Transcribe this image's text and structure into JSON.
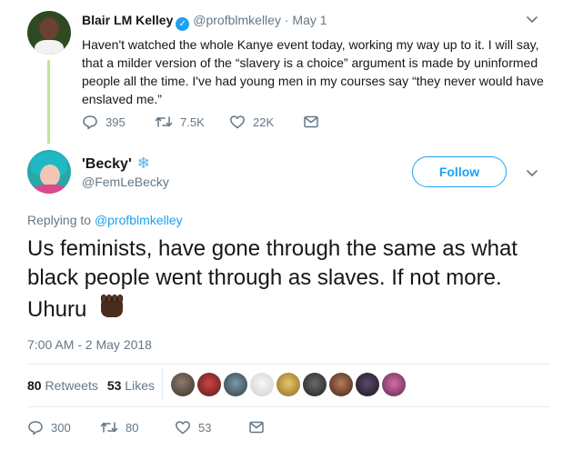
{
  "parent_tweet": {
    "author_name": "Blair LM Kelley",
    "verified_glyph": "✓",
    "handle": "@profblmkelley",
    "dot": "·",
    "date": "May 1",
    "text": "Haven't watched the whole Kanye event today, working my way up to it. I will say, that a milder version of the “slavery is a choice” argument is made by uninformed people all the time. I've had young men in my courses say “they never would have enslaved me.”",
    "actions": {
      "replies": "395",
      "retweets": "7.5K",
      "likes": "22K"
    },
    "icons": [
      "avatar",
      "verified-badge-icon",
      "chevron-down-icon",
      "reply-icon",
      "retweet-icon",
      "like-icon",
      "direct-message-icon"
    ]
  },
  "main_tweet": {
    "author_name": "'Becky'",
    "name_emoji": "❄",
    "handle": "@FemLeBecky",
    "follow_label": "Follow",
    "replying_prefix": "Replying to",
    "replying_to": "@profblmkelley",
    "text": "Us feminists, have gone through the same as what black people went through as slaves. If not more. Uhuru",
    "text_emoji": "raised-fist-dark-skin-tone",
    "timestamp": "7:00 AM - 2 May 2018",
    "stats": {
      "retweets_count": "80",
      "retweets_label": "Retweets",
      "likes_count": "53",
      "likes_label": "Likes"
    },
    "liker_avatars": 9,
    "actions": {
      "replies": "300",
      "retweets": "80",
      "likes": "53"
    }
  },
  "colors": {
    "accent": "#1da1f2",
    "secondary_text": "#657786",
    "primary_text": "#14171a",
    "thread_line": "#c4e39a",
    "divider": "#e6ecf0"
  }
}
